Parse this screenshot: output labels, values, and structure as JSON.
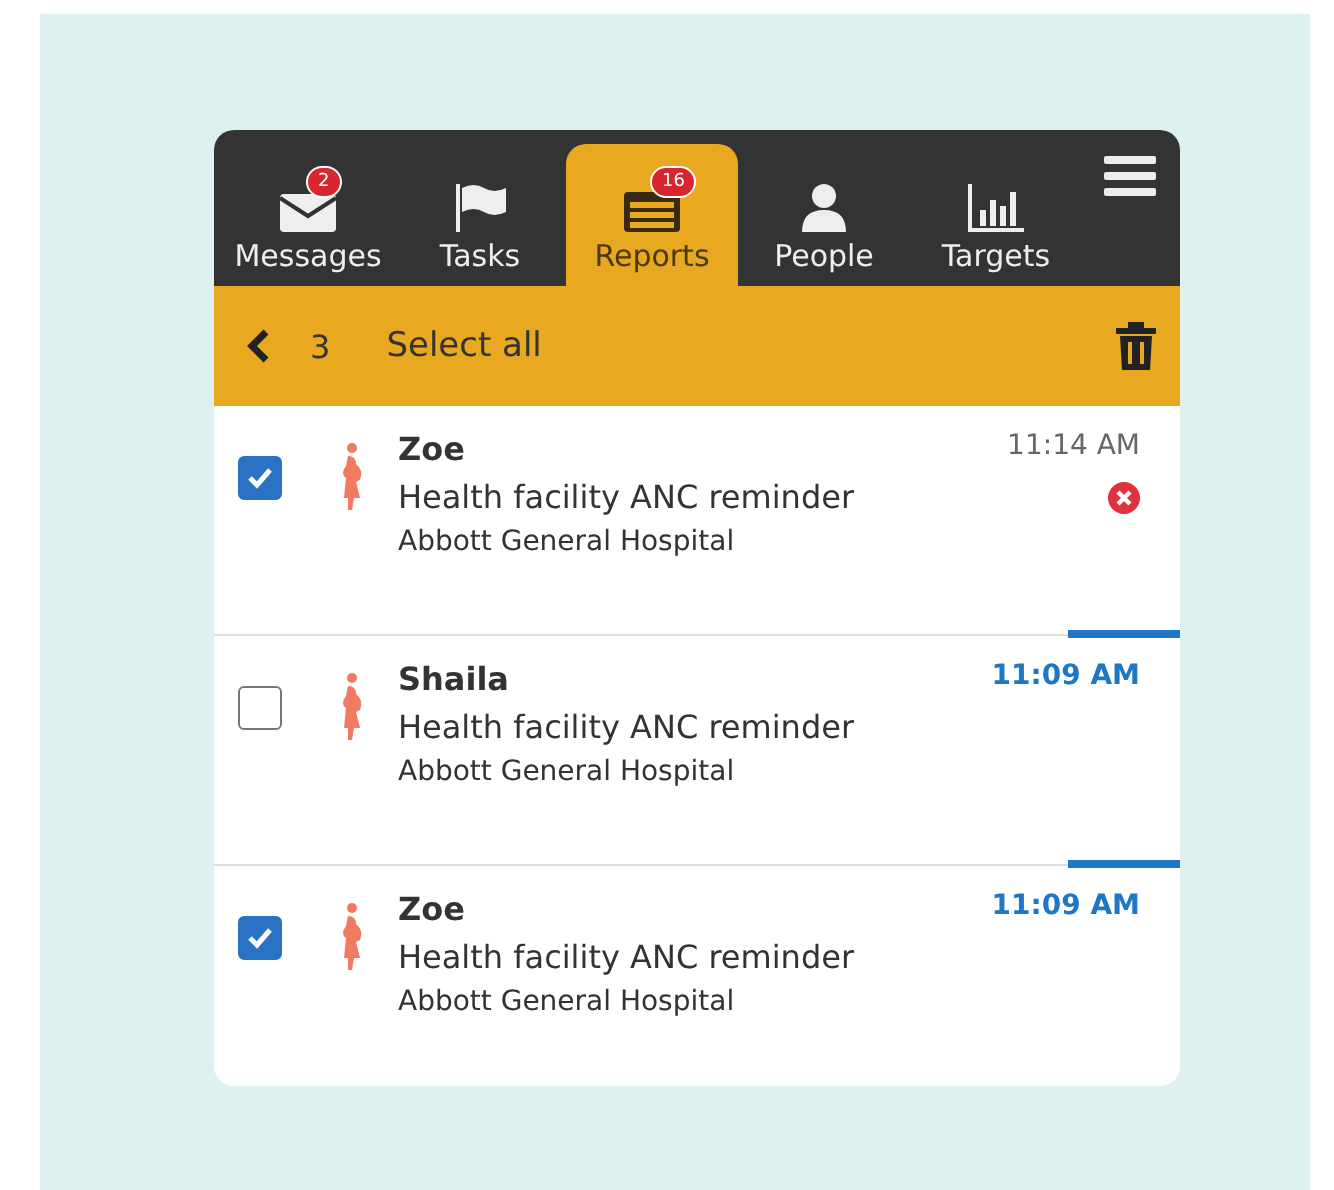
{
  "tabs": [
    {
      "label": "Messages",
      "kind": "envelope",
      "badge": "2",
      "selected": false
    },
    {
      "label": "Tasks",
      "kind": "flag",
      "selected": false
    },
    {
      "label": "Reports",
      "kind": "form",
      "badge": "16",
      "selected": true
    },
    {
      "label": "People",
      "kind": "person",
      "selected": false
    },
    {
      "label": "Targets",
      "kind": "chart",
      "selected": false
    }
  ],
  "selection_bar": {
    "count": "3",
    "select_all": "Select all"
  },
  "reports": [
    {
      "name": "Zoe",
      "form": "Health facility ANC reminder",
      "place": "Abbott General Hospital",
      "time": "11:14 AM",
      "checked": true,
      "unread": false,
      "error": true
    },
    {
      "name": "Shaila",
      "form": "Health facility ANC reminder",
      "place": "Abbott General Hospital",
      "time": "11:09 AM",
      "checked": false,
      "unread": true,
      "error": false
    },
    {
      "name": "Zoe",
      "form": "Health facility ANC reminder",
      "place": "Abbott General Hospital",
      "time": "11:09 AM",
      "checked": true,
      "unread": true,
      "error": false
    }
  ]
}
